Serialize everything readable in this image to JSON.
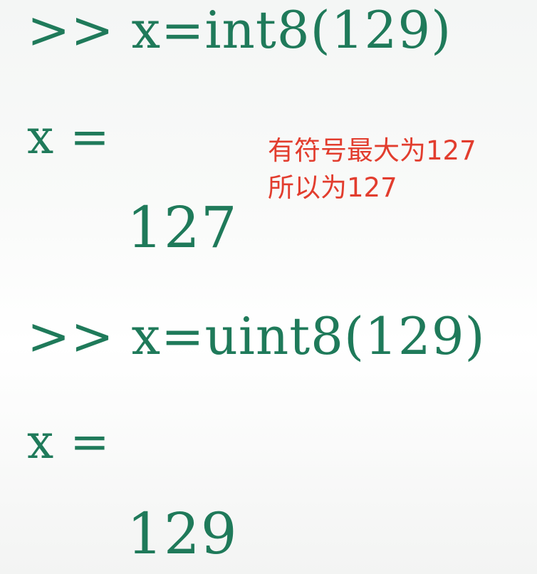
{
  "console": {
    "command_1": ">> x=int8(129)",
    "output_label_1": "x =",
    "output_value_1": "127",
    "command_2": ">> x=uint8(129)",
    "output_label_2": "x =",
    "output_value_2": "129"
  },
  "annotation": {
    "line_1": "有符号最大为127",
    "line_2": "所以为127"
  },
  "colors": {
    "console_text": "#1f7a5a",
    "annotation_text": "#e23d2e"
  }
}
